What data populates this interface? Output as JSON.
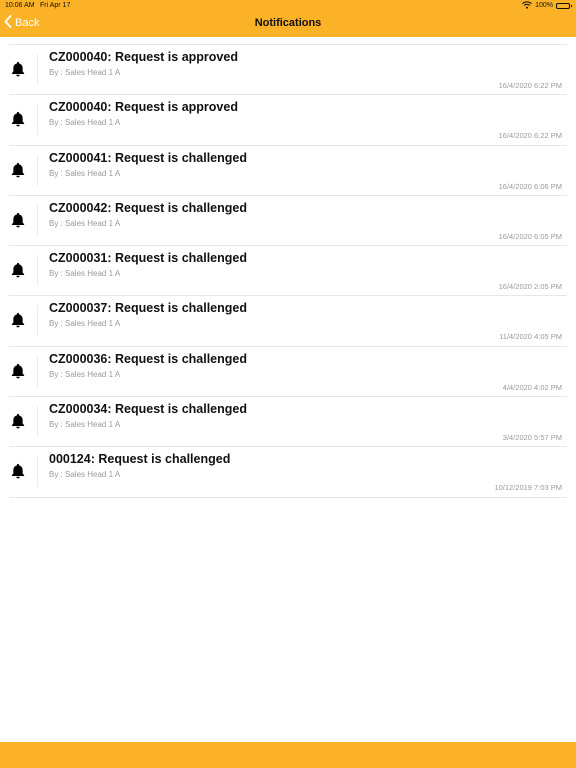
{
  "status_bar": {
    "time": "10:06 AM",
    "date": "Fri Apr 17",
    "battery": "100%"
  },
  "nav": {
    "back_label": "Back",
    "title": "Notifications"
  },
  "notifications": [
    {
      "title": "CZ000040: Request is approved",
      "by": "By : Sales Head 1 A",
      "time": "16/4/2020 6:22 PM"
    },
    {
      "title": "CZ000040: Request is approved",
      "by": "By : Sales Head 1 A",
      "time": "16/4/2020 6:22 PM"
    },
    {
      "title": "CZ000041: Request is challenged",
      "by": "By : Sales Head 1 A",
      "time": "16/4/2020 6:06 PM"
    },
    {
      "title": "CZ000042: Request is challenged",
      "by": "By : Sales Head 1 A",
      "time": "16/4/2020 6:05 PM"
    },
    {
      "title": "CZ000031: Request is challenged",
      "by": "By : Sales Head 1 A",
      "time": "16/4/2020 2:05 PM"
    },
    {
      "title": "CZ000037: Request is challenged",
      "by": "By : Sales Head 1 A",
      "time": "11/4/2020 4:05 PM"
    },
    {
      "title": "CZ000036: Request is challenged",
      "by": "By : Sales Head 1 A",
      "time": "4/4/2020 4:02 PM"
    },
    {
      "title": "CZ000034: Request is challenged",
      "by": "By : Sales Head 1 A",
      "time": "3/4/2020 5:57 PM"
    },
    {
      "title": "000124: Request is challenged",
      "by": "By : Sales Head 1 A",
      "time": "10/12/2019 7:03 PM"
    }
  ],
  "icons": {
    "back": "chevron-left-icon",
    "notification": "bell-icon",
    "wifi": "wifi-icon",
    "battery": "battery-icon"
  },
  "colors": {
    "accent": "#fcb226",
    "secondary_text": "#9a9a9a",
    "divider": "#e6e6e6"
  }
}
